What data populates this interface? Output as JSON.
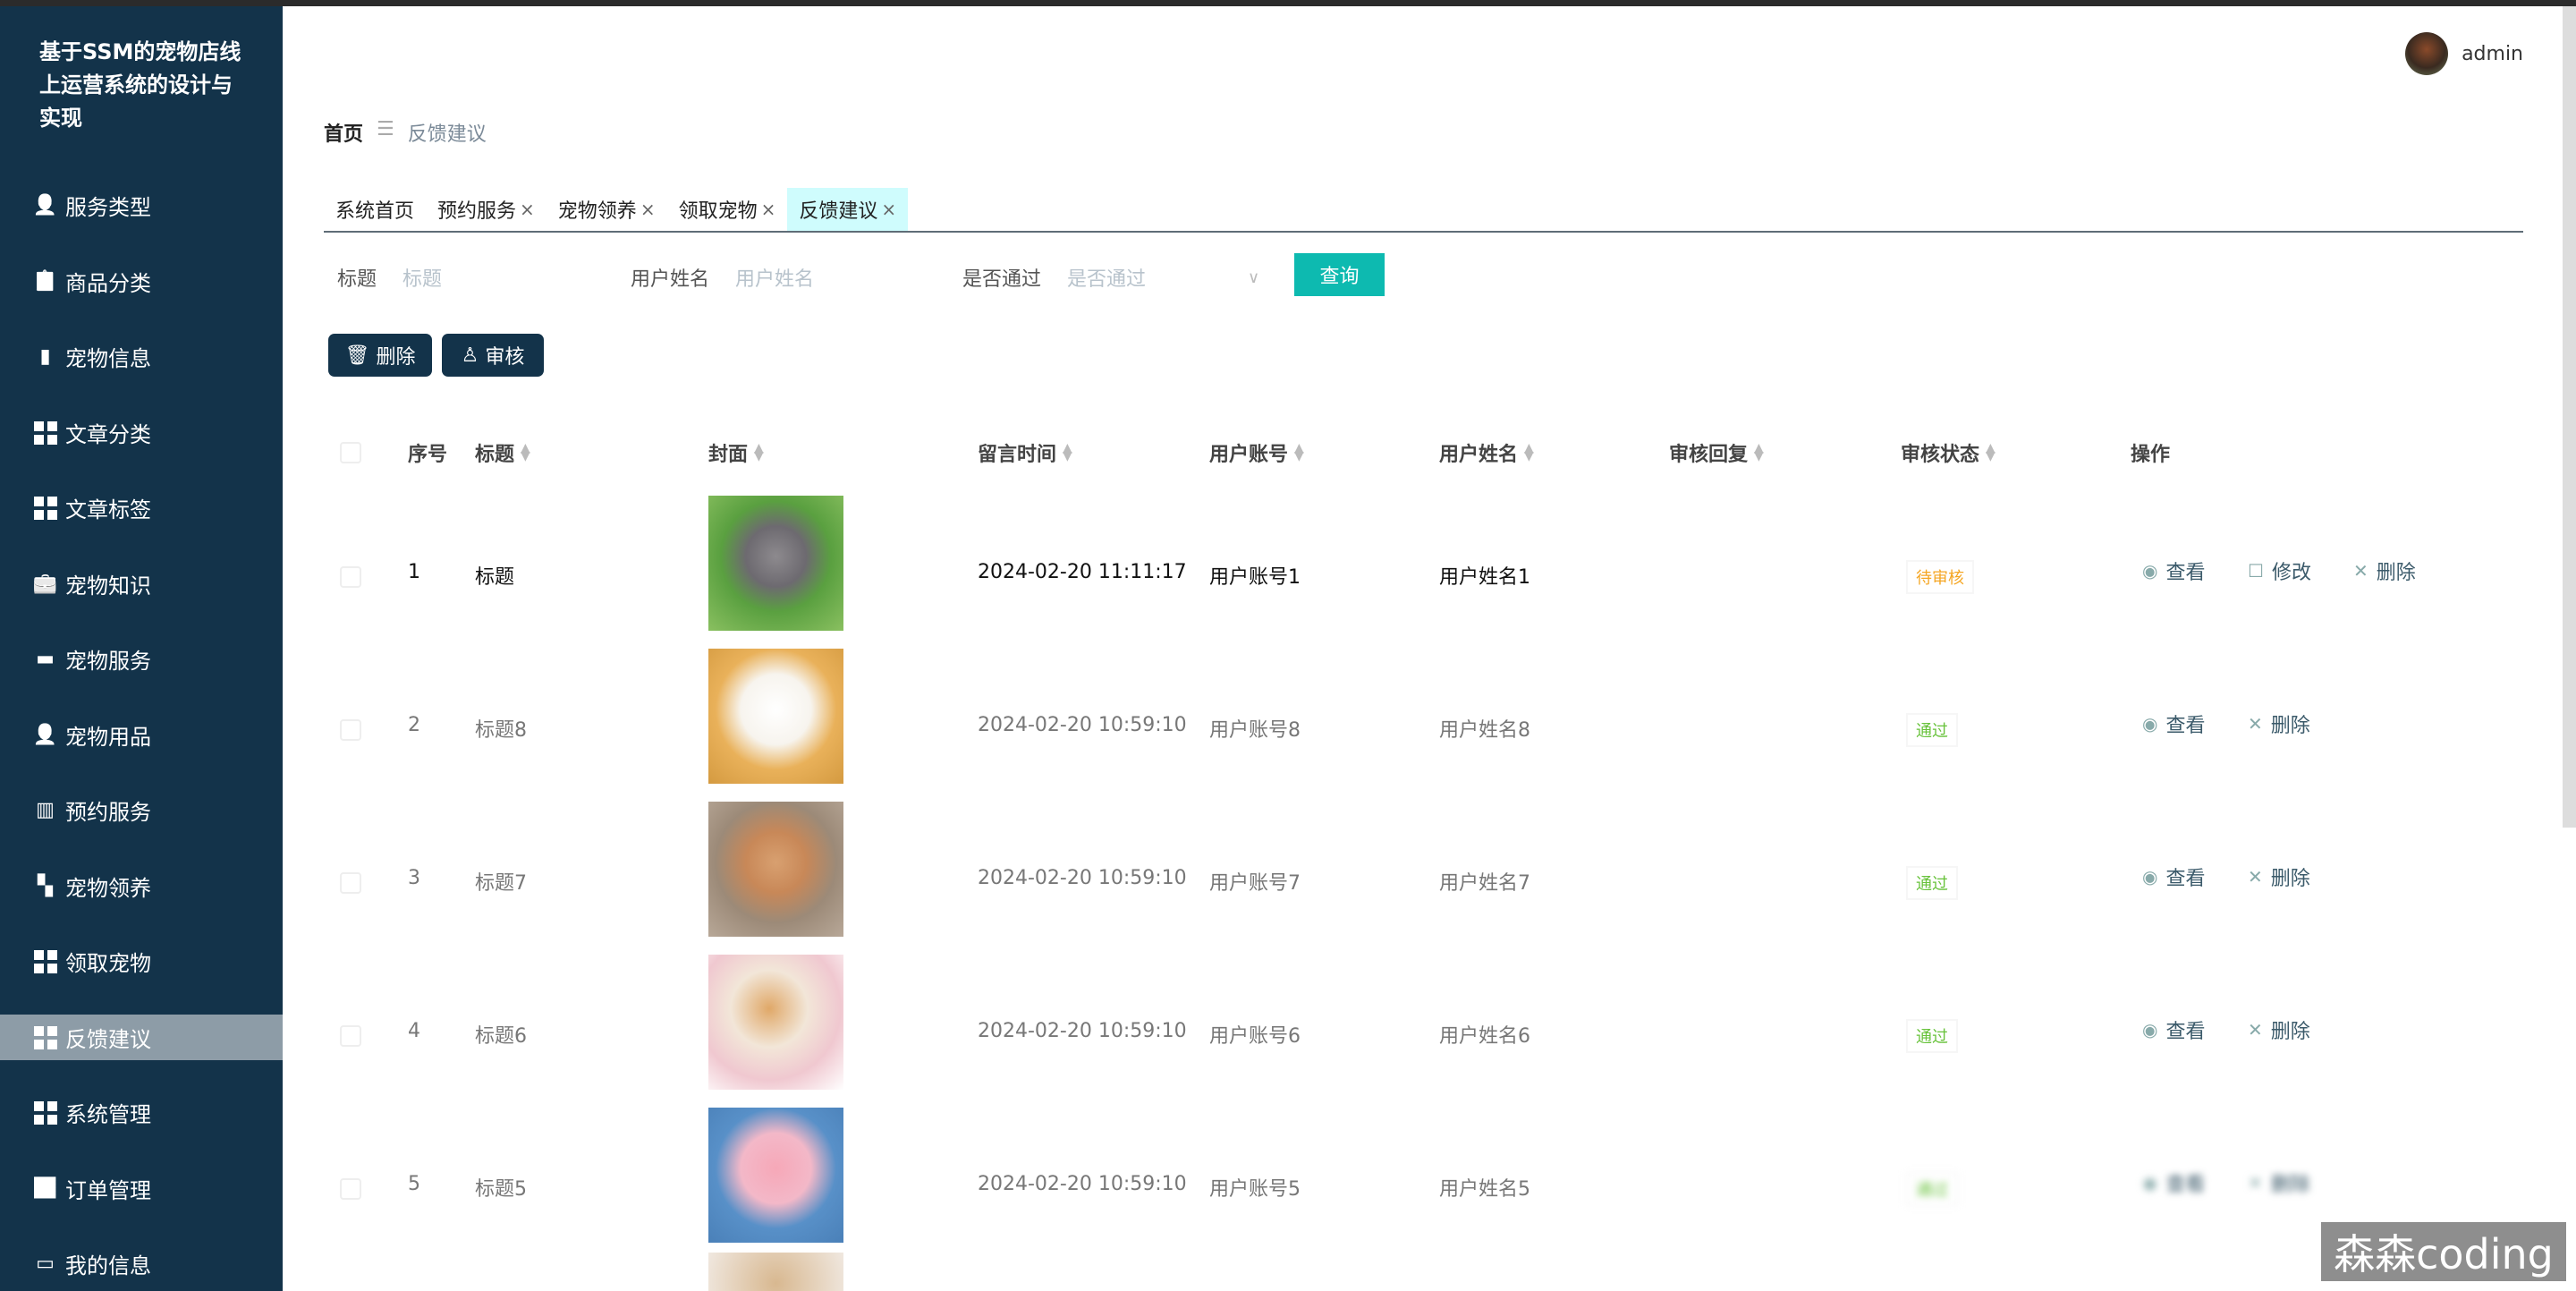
{
  "app_title": "基于SSM的宠物店线上运营系统的设计与实现",
  "user": {
    "name": "admin"
  },
  "sidebar": {
    "items": [
      {
        "label": "服务类型",
        "icon": "user-icon"
      },
      {
        "label": "商品分类",
        "icon": "clipboard-icon"
      },
      {
        "label": "宠物信息",
        "icon": "bar-chart-icon"
      },
      {
        "label": "文章分类",
        "icon": "grid-icon"
      },
      {
        "label": "文章标签",
        "icon": "grid-icon"
      },
      {
        "label": "宠物知识",
        "icon": "briefcase-icon"
      },
      {
        "label": "宠物服务",
        "icon": "inbox-icon"
      },
      {
        "label": "宠物用品",
        "icon": "person-icon"
      },
      {
        "label": "预约服务",
        "icon": "book-icon"
      },
      {
        "label": "宠物领养",
        "icon": "ticket-icon"
      },
      {
        "label": "领取宠物",
        "icon": "grid-icon"
      },
      {
        "label": "反馈建议",
        "icon": "grid-icon",
        "active": true
      },
      {
        "label": "系统管理",
        "icon": "grid-icon"
      },
      {
        "label": "订单管理",
        "icon": "chart-icon"
      },
      {
        "label": "我的信息",
        "icon": "card-icon"
      }
    ]
  },
  "breadcrumb": {
    "home": "首页",
    "separator": "☰",
    "current": "反馈建议"
  },
  "tabs": [
    {
      "label": "系统首页",
      "closable": false
    },
    {
      "label": "预约服务",
      "closable": true
    },
    {
      "label": "宠物领养",
      "closable": true
    },
    {
      "label": "领取宠物",
      "closable": true
    },
    {
      "label": "反馈建议",
      "closable": true,
      "active": true
    }
  ],
  "close_glyph": "×",
  "filters": {
    "title": {
      "label": "标题",
      "placeholder": "标题"
    },
    "username": {
      "label": "用户姓名",
      "placeholder": "用户姓名"
    },
    "passed": {
      "label": "是否通过",
      "placeholder": "是否通过"
    },
    "query_button": "查询"
  },
  "actions": {
    "delete": "删除",
    "review": "审核"
  },
  "table": {
    "columns": [
      "序号",
      "标题",
      "封面",
      "留言时间",
      "用户账号",
      "用户姓名",
      "审核回复",
      "审核状态",
      "操作"
    ],
    "rows": [
      {
        "no": "1",
        "title": "标题",
        "time": "2024-02-20 11:11:17",
        "account": "用户账号1",
        "name": "用户姓名1",
        "reply": "",
        "status": "待审核",
        "status_color": "#f5a623",
        "ops": [
          "查看",
          "修改",
          "删除"
        ]
      },
      {
        "no": "2",
        "title": "标题8",
        "time": "2024-02-20 10:59:10",
        "account": "用户账号8",
        "name": "用户姓名8",
        "reply": "",
        "status": "通过",
        "status_color": "#67c23a",
        "ops": [
          "查看",
          "删除"
        ]
      },
      {
        "no": "3",
        "title": "标题7",
        "time": "2024-02-20 10:59:10",
        "account": "用户账号7",
        "name": "用户姓名7",
        "reply": "",
        "status": "通过",
        "status_color": "#67c23a",
        "ops": [
          "查看",
          "删除"
        ]
      },
      {
        "no": "4",
        "title": "标题6",
        "time": "2024-02-20 10:59:10",
        "account": "用户账号6",
        "name": "用户姓名6",
        "reply": "",
        "status": "通过",
        "status_color": "#67c23a",
        "ops": [
          "查看",
          "删除"
        ]
      },
      {
        "no": "5",
        "title": "标题5",
        "time": "2024-02-20 10:59:10",
        "account": "用户账号5",
        "name": "用户姓名5",
        "reply": "",
        "status": "通过",
        "status_color": "#67c23a",
        "ops": [
          "查看",
          "删除"
        ]
      }
    ]
  },
  "watermark": "森森coding"
}
